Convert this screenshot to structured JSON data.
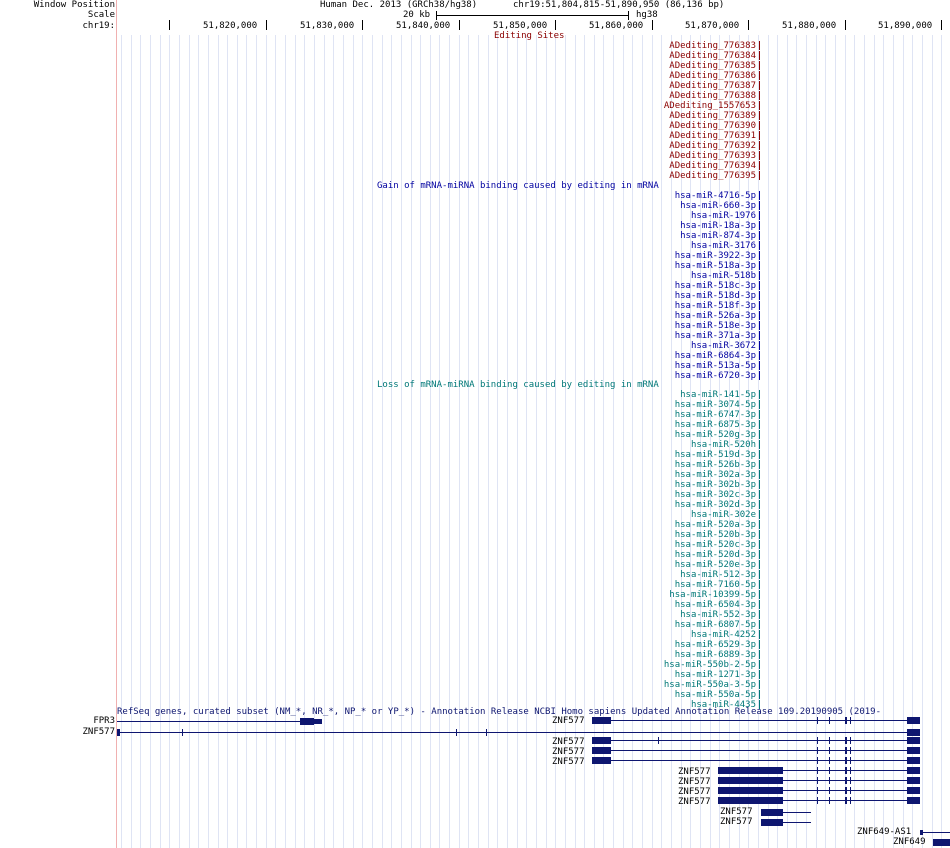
{
  "labels": {
    "window_position": "Window Position",
    "scale": "Scale",
    "chrom": "chr19:"
  },
  "header": {
    "assembly": "Human Dec. 2013 (GRCh38/hg38)",
    "position": "chr19:51,804,815-51,890,950 (86,136 bp)",
    "scale_bar": "20 kb",
    "db": "hg38"
  },
  "ruler": {
    "ticks": [
      "51,820,000",
      "51,830,000",
      "51,840,000",
      "51,850,000",
      "51,860,000",
      "51,870,000",
      "51,880,000",
      "51,890,000"
    ]
  },
  "editing_track": {
    "title": "Editing Sites",
    "color": "#8b0000",
    "items": [
      "ADediting_776383",
      "ADediting_776384",
      "ADediting_776385",
      "ADediting_776386",
      "ADediting_776387",
      "ADediting_776388",
      "ADediting_1557653",
      "ADediting_776389",
      "ADediting_776390",
      "ADediting_776391",
      "ADediting_776392",
      "ADediting_776393",
      "ADediting_776394",
      "ADediting_776395"
    ]
  },
  "gain_track": {
    "title": "Gain of mRNA-miRNA binding caused by editing in mRNA",
    "color": "#0000a0",
    "items": [
      "hsa-miR-4716-5p",
      "hsa-miR-660-3p",
      "hsa-miR-1976",
      "hsa-miR-18a-3p",
      "hsa-miR-874-3p",
      "hsa-miR-3176",
      "hsa-miR-3922-3p",
      "hsa-miR-518a-3p",
      "hsa-miR-518b",
      "hsa-miR-518c-3p",
      "hsa-miR-518d-3p",
      "hsa-miR-518f-3p",
      "hsa-miR-526a-3p",
      "hsa-miR-518e-3p",
      "hsa-miR-371a-3p",
      "hsa-miR-3672",
      "hsa-miR-6864-3p",
      "hsa-miR-513a-5p",
      "hsa-miR-6720-3p"
    ]
  },
  "loss_track": {
    "title": "Loss of mRNA-miRNA binding caused by editing in mRNA",
    "color": "#007878",
    "items": [
      "hsa-miR-141-5p",
      "hsa-miR-3074-5p",
      "hsa-miR-6747-3p",
      "hsa-miR-6875-3p",
      "hsa-miR-520g-3p",
      "hsa-miR-520h",
      "hsa-miR-519d-3p",
      "hsa-miR-526b-3p",
      "hsa-miR-302a-3p",
      "hsa-miR-302b-3p",
      "hsa-miR-302c-3p",
      "hsa-miR-302d-3p",
      "hsa-miR-302e",
      "hsa-miR-520a-3p",
      "hsa-miR-520b-3p",
      "hsa-miR-520c-3p",
      "hsa-miR-520d-3p",
      "hsa-miR-520e-3p",
      "hsa-miR-512-3p",
      "hsa-miR-7160-5p",
      "hsa-miR-10399-5p",
      "hsa-miR-6504-3p",
      "hsa-miR-552-3p",
      "hsa-miR-6807-5p",
      "hsa-miR-4252",
      "hsa-miR-6529-3p",
      "hsa-miR-6889-3p",
      "hsa-miR-550b-2-5p",
      "hsa-miR-1271-3p",
      "hsa-miR-550a-3-5p",
      "hsa-miR-550a-5p",
      "hsa-miR-4435"
    ]
  },
  "refseq_track": {
    "title": "RefSeq genes, curated subset (NM_*, NR_*, NP_* or YP_*) - Annotation Release NCBI Homo sapiens Updated Annotation Release 109.20190905 (2019-",
    "color": "#0e1670",
    "left_labels": [
      "FPR3",
      "ZNF577"
    ],
    "gene_labels": [
      "ZNF577",
      "ZNF577",
      "ZNF577",
      "ZNF577",
      "ZNF577",
      "ZNF577",
      "ZNF577",
      "ZNF577",
      "ZNF577",
      "ZNF577",
      "ZNF649-AS1",
      "ZNF649"
    ]
  },
  "colors": {
    "grid": "#dfe4f4",
    "left_border": "#f0b0b0",
    "gene": "#0e1670"
  }
}
